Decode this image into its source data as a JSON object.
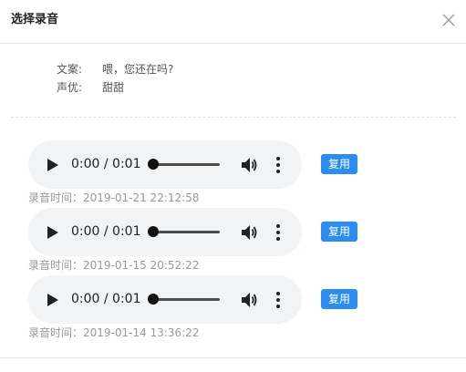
{
  "dialog": {
    "title": "选择录音",
    "close_icon": "close-icon"
  },
  "info": {
    "script_label": "文案:",
    "script_value": "喂，您还在吗?",
    "voice_label": "声优:",
    "voice_value": "甜甜"
  },
  "recordings": [
    {
      "time_display": "0:00 / 0:01",
      "reuse_label": "复用",
      "recorded_at": "录音时间：2019-01-21 22:12:58",
      "progress": 0
    },
    {
      "time_display": "0:00 / 0:01",
      "reuse_label": "复用",
      "recorded_at": "录音时间：2019-01-15 20:52:22",
      "progress": 0
    },
    {
      "time_display": "0:00 / 0:01",
      "reuse_label": "复用",
      "recorded_at": "录音时间：2019-01-14 13:36:22",
      "progress": 0
    }
  ],
  "icons": {
    "play": "play-icon",
    "volume": "volume-icon",
    "more": "more-vertical-icon"
  },
  "colors": {
    "accent": "#2d8cf0",
    "player_bg": "#f1f3f4",
    "muted_text": "#999999"
  }
}
